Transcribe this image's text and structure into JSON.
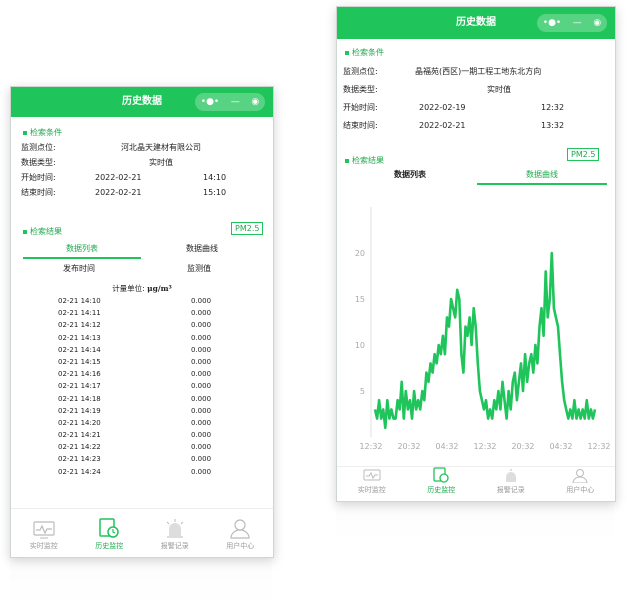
{
  "header": {
    "title": "历史数据",
    "capsule_more": "•●•",
    "capsule_minimize": "—",
    "capsule_close": "◉"
  },
  "colors": {
    "accent": "#1fc45a",
    "accent_text": "#1fa84e"
  },
  "left": {
    "conditions_title": "检索条件",
    "monitor_label": "监测点位:",
    "monitor_value": "河北晶天建材有限公司",
    "type_label": "数据类型:",
    "type_value": "实时值",
    "start_label": "开始时间:",
    "start_date": "2022-02-21",
    "start_time": "14:10",
    "end_label": "结束时间:",
    "end_date": "2022-02-21",
    "end_time": "15:10",
    "results_title": "检索结果",
    "pm": "PM2.5",
    "tab_list": "数据列表",
    "tab_curve": "数据曲线",
    "col_time": "发布时间",
    "col_value": "监测值",
    "unit_label": "计量单位:",
    "unit_value": "μg/m³",
    "rows": [
      {
        "t": "02-21 14:10",
        "v": "0.000"
      },
      {
        "t": "02-21 14:11",
        "v": "0.000"
      },
      {
        "t": "02-21 14:12",
        "v": "0.000"
      },
      {
        "t": "02-21 14:13",
        "v": "0.000"
      },
      {
        "t": "02-21 14:14",
        "v": "0.000"
      },
      {
        "t": "02-21 14:15",
        "v": "0.000"
      },
      {
        "t": "02-21 14:16",
        "v": "0.000"
      },
      {
        "t": "02-21 14:17",
        "v": "0.000"
      },
      {
        "t": "02-21 14:18",
        "v": "0.000"
      },
      {
        "t": "02-21 14:19",
        "v": "0.000"
      },
      {
        "t": "02-21 14:20",
        "v": "0.000"
      },
      {
        "t": "02-21 14:21",
        "v": "0.000"
      },
      {
        "t": "02-21 14:22",
        "v": "0.000"
      },
      {
        "t": "02-21 14:23",
        "v": "0.000"
      },
      {
        "t": "02-21 14:24",
        "v": "0.000"
      }
    ]
  },
  "right": {
    "conditions_title": "检索条件",
    "monitor_label": "监测点位:",
    "monitor_value": "晶福苑(西区)一期工程工地东北方向",
    "type_label": "数据类型:",
    "type_value": "实时值",
    "start_label": "开始时间:",
    "start_date": "2022-02-19",
    "start_time": "12:32",
    "end_label": "结束时间:",
    "end_date": "2022-02-21",
    "end_time": "13:32",
    "results_title": "检索结果",
    "pm": "PM2.5",
    "tab_list": "数据列表",
    "tab_curve": "数据曲线"
  },
  "nav": [
    {
      "label": "实时监控",
      "icon": "monitor-icon"
    },
    {
      "label": "历史监控",
      "icon": "history-icon"
    },
    {
      "label": "报警记录",
      "icon": "alarm-icon"
    },
    {
      "label": "用户中心",
      "icon": "user-icon"
    }
  ],
  "chart_data": {
    "type": "line",
    "title": "",
    "xlabel": "",
    "ylabel": "",
    "ylim": [
      0,
      25
    ],
    "y_ticks": [
      "5",
      "10",
      "15",
      "20"
    ],
    "x_tick_labels": [
      "12:32",
      "20:32",
      "04:32",
      "12:32",
      "20:32",
      "04:32",
      "12:32"
    ],
    "series": [
      {
        "values": [
          3,
          2,
          4,
          2,
          3,
          1,
          4,
          2,
          3,
          2,
          2,
          4,
          3,
          6,
          2,
          5,
          3,
          4,
          2,
          5,
          3,
          4,
          3,
          5,
          4,
          7,
          6,
          8,
          7,
          9,
          8,
          10,
          9,
          11,
          9,
          13,
          12,
          15,
          14,
          13,
          16,
          15,
          9,
          7,
          12,
          11,
          13,
          10,
          14,
          12,
          8,
          5,
          4,
          3,
          4,
          2,
          3,
          2,
          4,
          3,
          5,
          3,
          6,
          4,
          2,
          5,
          3,
          6,
          7,
          4,
          6,
          8,
          5,
          9,
          6,
          8,
          9,
          7,
          10,
          8,
          12,
          14,
          11,
          18,
          13,
          15,
          20,
          14,
          13,
          12,
          9,
          6,
          4,
          3,
          2,
          3,
          2,
          4,
          2,
          3,
          2,
          3,
          2,
          4,
          2,
          3,
          2,
          3
        ]
      }
    ]
  }
}
